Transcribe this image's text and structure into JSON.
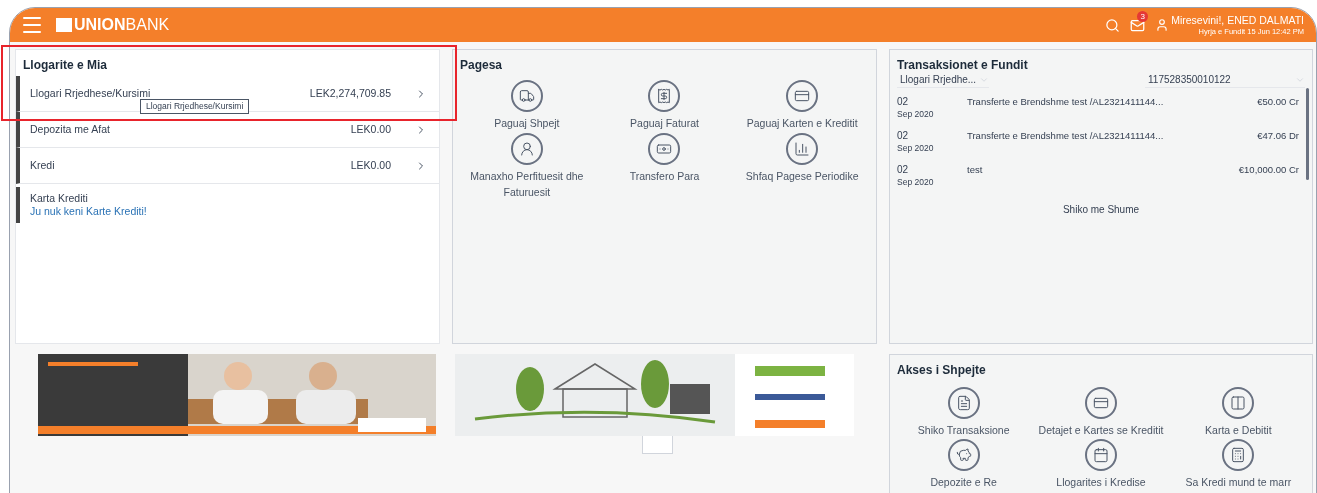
{
  "header": {
    "logo_bold": "UNION",
    "logo_light": "BANK",
    "notifications": "3",
    "greeting": "Miresevini!, ENED DALMATI",
    "last_login": "Hyrja e Fundit 15 Jun 12:42 PM"
  },
  "accounts": {
    "title": "Llogarite e Mia",
    "tooltip": "Llogari Rrjedhese/Kursimi",
    "items": [
      {
        "kind": "balance",
        "label": "Llogari Rrjedhese/Kursimi",
        "amount": "LEK2,274,709.85"
      },
      {
        "kind": "balance",
        "label": "Depozita me Afat",
        "amount": "LEK0.00"
      },
      {
        "kind": "balance",
        "label": "Kredi",
        "amount": "LEK0.00"
      },
      {
        "kind": "message",
        "label": "Karta Krediti",
        "message": "Ju nuk keni Karte Krediti!"
      }
    ]
  },
  "payments": {
    "title": "Pagesa",
    "actions": [
      {
        "label": "Paguaj Shpejt"
      },
      {
        "label": "Paguaj Faturat"
      },
      {
        "label": "Paguaj Karten e Kreditit"
      },
      {
        "label": "Manaxho Perfituesit dhe Faturuesit"
      },
      {
        "label": "Transfero Para"
      },
      {
        "label": "Shfaq Pagese Periodike"
      }
    ]
  },
  "transactions": {
    "title": "Transaksionet e Fundit",
    "account_select": "Llogari Rrjedhe...",
    "number_select": "117528350010122",
    "rows": [
      {
        "day": "02",
        "month_year": "Sep 2020",
        "description": "Transferte e Brendshme test /AL2321411144...",
        "amount": "€50.00 Cr"
      },
      {
        "day": "02",
        "month_year": "Sep 2020",
        "description": "Transferte e Brendshme test /AL2321411144...",
        "amount": "€47.06 Dr"
      },
      {
        "day": "02",
        "month_year": "Sep 2020",
        "description": "test",
        "amount": "€10,000.00 Cr"
      }
    ],
    "more": "Shiko me Shume"
  },
  "quick_access": {
    "title": "Akses i Shpejte",
    "actions": [
      {
        "label": "Shiko Transaksione"
      },
      {
        "label": "Detajet e Kartes se Kreditit"
      },
      {
        "label": "Karta e Debitit"
      },
      {
        "label": "Depozite e Re"
      },
      {
        "label": "Llogarites i Kredise"
      },
      {
        "label": "Sa Kredi mund te marr"
      }
    ]
  }
}
